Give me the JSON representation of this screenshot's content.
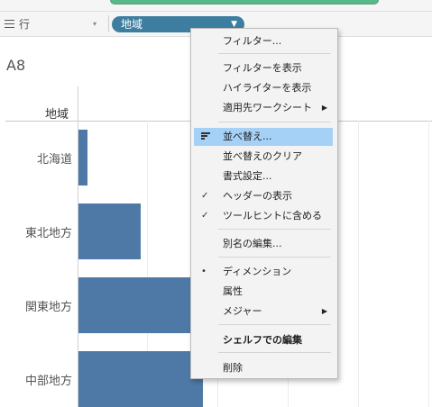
{
  "shelf": {
    "label": "行",
    "pill_label": "地域",
    "pill_color": "#3d7ea0"
  },
  "sheet": {
    "title": "A8",
    "row_header": "地域"
  },
  "chart_data": {
    "type": "bar",
    "orientation": "horizontal",
    "categories": [
      "北海道",
      "東北地方",
      "関東地方",
      "中部地方"
    ],
    "values": [
      1,
      7,
      13,
      14
    ],
    "bar_color": "#4e79a7"
  },
  "menu": {
    "items": [
      {
        "label": "フィルター...",
        "mark": "",
        "arrow": false,
        "bold": false,
        "highlighted": false
      },
      {
        "label": "フィルターを表示",
        "mark": "",
        "arrow": false,
        "bold": false,
        "highlighted": false
      },
      {
        "label": "ハイライターを表示",
        "mark": "",
        "arrow": false,
        "bold": false,
        "highlighted": false
      },
      {
        "label": "適用先ワークシート",
        "mark": "",
        "arrow": true,
        "bold": false,
        "highlighted": false
      },
      {
        "label": "並べ替え...",
        "mark": "sort-icon",
        "arrow": false,
        "bold": false,
        "highlighted": true
      },
      {
        "label": "並べ替えのクリア",
        "mark": "",
        "arrow": false,
        "bold": false,
        "highlighted": false
      },
      {
        "label": "書式設定...",
        "mark": "",
        "arrow": false,
        "bold": false,
        "highlighted": false
      },
      {
        "label": "ヘッダーの表示",
        "mark": "✓",
        "arrow": false,
        "bold": false,
        "highlighted": false
      },
      {
        "label": "ツールヒントに含める",
        "mark": "✓",
        "arrow": false,
        "bold": false,
        "highlighted": false
      },
      {
        "label": "別名の編集...",
        "mark": "",
        "arrow": false,
        "bold": false,
        "highlighted": false
      },
      {
        "label": "ディメンション",
        "mark": "•",
        "arrow": false,
        "bold": false,
        "highlighted": false
      },
      {
        "label": "属性",
        "mark": "",
        "arrow": false,
        "bold": false,
        "highlighted": false
      },
      {
        "label": "メジャー",
        "mark": "",
        "arrow": true,
        "bold": false,
        "highlighted": false
      },
      {
        "label": "シェルフでの編集",
        "mark": "",
        "arrow": false,
        "bold": true,
        "highlighted": false
      },
      {
        "label": "削除",
        "mark": "",
        "arrow": false,
        "bold": false,
        "highlighted": false
      }
    ]
  }
}
